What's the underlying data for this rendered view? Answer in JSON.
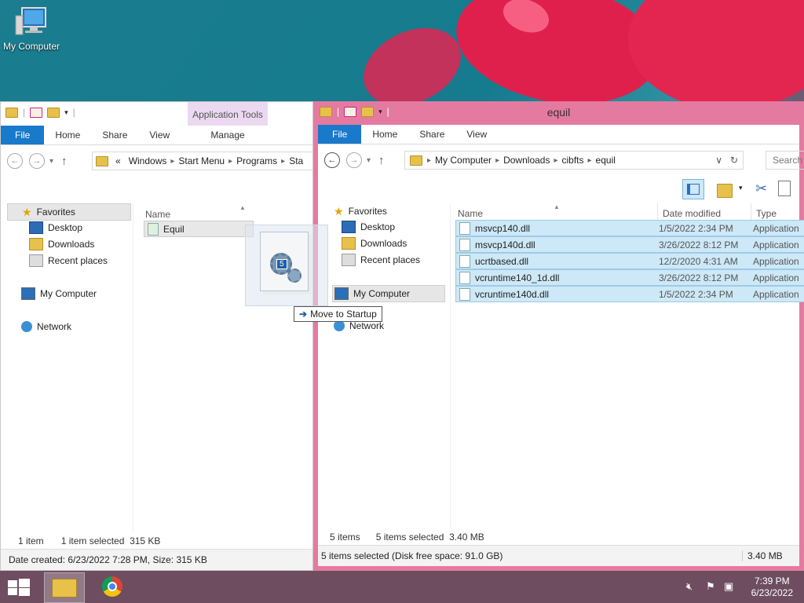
{
  "desktop": {
    "icon_label": "My Computer"
  },
  "left_window": {
    "context_tab": "Application Tools",
    "tabs": {
      "file": "File",
      "home": "Home",
      "share": "Share",
      "view": "View",
      "manage": "Manage"
    },
    "breadcrumb": [
      "«",
      "Windows",
      "Start Menu",
      "Programs",
      "Sta"
    ],
    "nav": {
      "favorites": "Favorites",
      "desktop": "Desktop",
      "downloads": "Downloads",
      "recent": "Recent places",
      "computer": "My Computer",
      "network": "Network"
    },
    "column_name": "Name",
    "files": [
      {
        "name": "Equil"
      }
    ],
    "status": {
      "items": "1 item",
      "selected": "1 item selected  315 KB"
    },
    "details": "Date created: 6/23/2022 7:28 PM, Size: 315 KB"
  },
  "right_window": {
    "title": "equil",
    "tabs": {
      "file": "File",
      "home": "Home",
      "share": "Share",
      "view": "View"
    },
    "breadcrumb": [
      "My Computer",
      "Downloads",
      "cibfts",
      "equil"
    ],
    "search_placeholder": "Search",
    "nav": {
      "favorites": "Favorites",
      "desktop": "Desktop",
      "downloads": "Downloads",
      "recent": "Recent places",
      "computer": "My Computer",
      "network": "Network"
    },
    "columns": {
      "name": "Name",
      "date": "Date modified",
      "type": "Type"
    },
    "files": [
      {
        "name": "msvcp140.dll",
        "date": "1/5/2022 2:34 PM",
        "type": "Application"
      },
      {
        "name": "msvcp140d.dll",
        "date": "3/26/2022 8:12 PM",
        "type": "Application"
      },
      {
        "name": "ucrtbased.dll",
        "date": "12/2/2020 4:31 AM",
        "type": "Application"
      },
      {
        "name": "vcruntime140_1d.dll",
        "date": "3/26/2022 8:12 PM",
        "type": "Application"
      },
      {
        "name": "vcruntime140d.dll",
        "date": "1/5/2022 2:34 PM",
        "type": "Application"
      }
    ],
    "status": {
      "items": "5 items",
      "selected": "5 items selected  3.40 MB"
    },
    "details": "5 items selected (Disk free space: 91.0 GB)",
    "details_size": "3.40 MB"
  },
  "drag": {
    "badge": "5",
    "tooltip": "Move to Startup"
  },
  "taskbar": {
    "time": "7:39 PM",
    "date": "6/23/2022"
  },
  "colors": {
    "accent": "#1979ca",
    "active_border": "#e57aa0",
    "selection": "#cde8f7"
  }
}
